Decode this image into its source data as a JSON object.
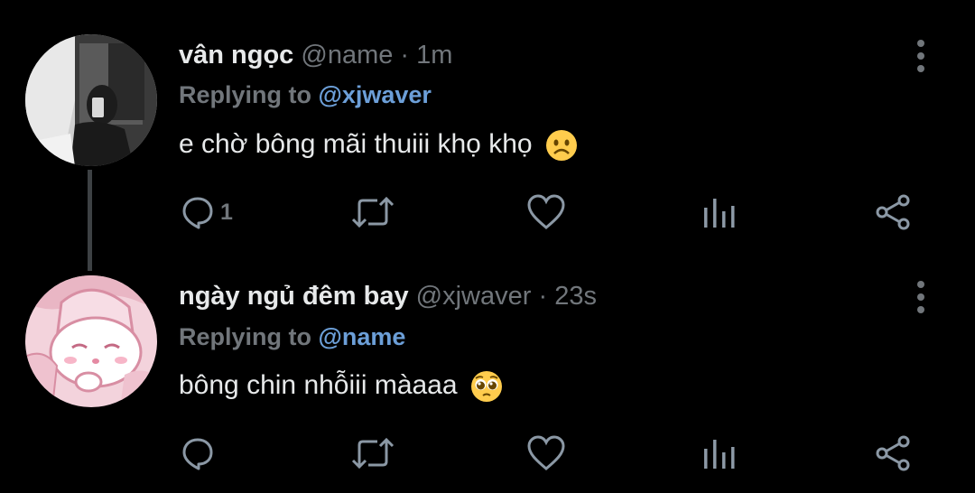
{
  "tweets": [
    {
      "author_name": "vân ngọc",
      "handle": "@name",
      "separator": "·",
      "time": "1m",
      "replying_prefix": "Replying to",
      "replying_to": "@xjwaver",
      "text": "e chờ bông mãi thuiii khọ khọ",
      "emoji": "frowning-face",
      "reply_count": "1"
    },
    {
      "author_name": "ngày ngủ đêm bay",
      "handle": "@xjwaver",
      "separator": "·",
      "time": "23s",
      "replying_prefix": "Replying to",
      "replying_to": "@name",
      "text": "bông chin nhỗiii màaaa",
      "emoji": "pleading-face",
      "reply_count": ""
    }
  ],
  "colors": {
    "background": "#000000",
    "text": "#e7e9ea",
    "muted": "#71767b",
    "mention": "#6c9fd8",
    "icon": "#8b98a5"
  },
  "icons": [
    "reply-icon",
    "retweet-icon",
    "like-icon",
    "analytics-icon",
    "share-icon",
    "more-icon"
  ]
}
